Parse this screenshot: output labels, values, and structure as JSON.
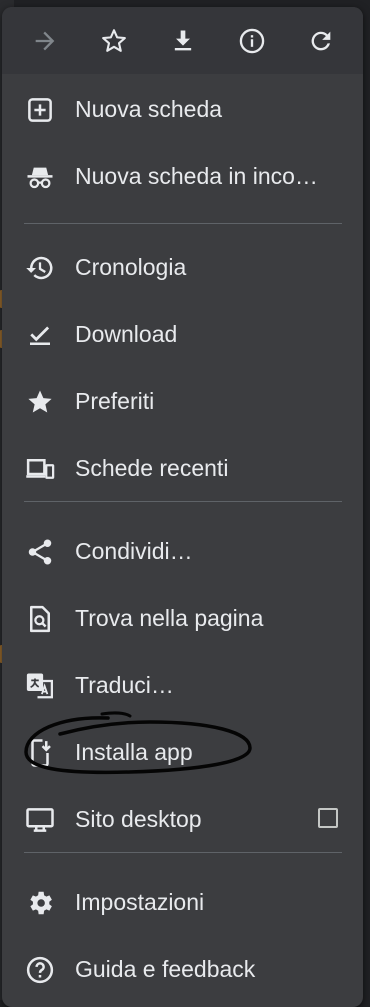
{
  "toolbar": {
    "buttons": [
      {
        "icon": "forward-arrow-icon"
      },
      {
        "icon": "star-outline-icon"
      },
      {
        "icon": "download-icon"
      },
      {
        "icon": "info-icon"
      },
      {
        "icon": "refresh-icon"
      }
    ]
  },
  "menu": {
    "new_tab": "Nuova scheda",
    "new_incognito_tab": "Nuova scheda in inco…",
    "history": "Cronologia",
    "downloads": "Download",
    "bookmarks": "Preferiti",
    "recent_tabs": "Schede recenti",
    "share": "Condividi…",
    "find_in_page": "Trova nella pagina",
    "translate": "Traduci…",
    "install_app": "Installa app",
    "desktop_site": "Sito desktop",
    "settings": "Impostazioni",
    "help_feedback": "Guida e feedback"
  },
  "desktop_site_checked": false,
  "colors": {
    "menu_bg": "#3c3d40",
    "toolbar_bg": "#35363a",
    "text": "#e8eaed",
    "icon": "#e8eaed",
    "divider": "#5f6368"
  }
}
